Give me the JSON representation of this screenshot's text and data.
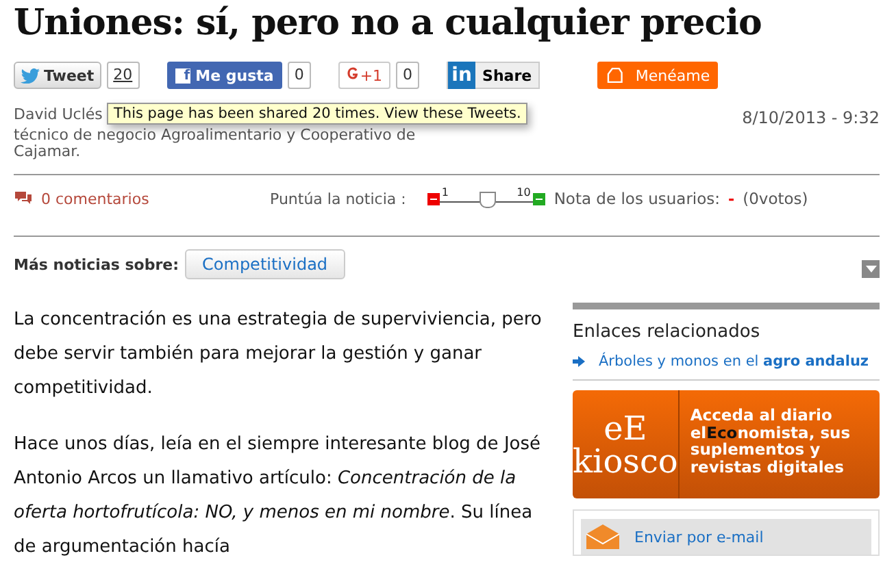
{
  "title": "Uniones: sí, pero no a cualquier precio",
  "social": {
    "tweet": "Tweet",
    "tweet_count": "20",
    "like_logo": "f",
    "like": "Me gusta",
    "like_count": "0",
    "gplus": "+1",
    "gplus_count": "0",
    "linkedin_logo": "in",
    "linkedin": "Share",
    "meneame": "Menéame"
  },
  "tooltip": "This page has been shared 20 times. View these Tweets.",
  "author": {
    "name": "David Uclés",
    "role": "técnico de negocio Agroalimentario y Cooperativo de Cajamar.",
    "date": "8/10/2013 - 9:32"
  },
  "comments": "0 comentarios",
  "rating": {
    "label": "Puntúa la noticia :",
    "min": "1",
    "max": "10",
    "level": 0.5,
    "users_label": "Nota de los usuarios:",
    "users_score": "-",
    "votes": "(0votos)"
  },
  "more_news": {
    "label": "Más noticias sobre:",
    "tags": [
      "Competitividad"
    ]
  },
  "paragraphs": [
    "La concentración es una estrategia de superviviencia, pero debe servir también para mejorar la gestión y ganar competitividad.",
    "Hace unos días, leía en el siempre interesante blog de José Antonio Arcos un llamativo artículo: *Concentración de la oferta hortofrutícola: NO, y menos en mi nombre*. Su línea de argumentación hacía"
  ],
  "sidebar": {
    "heading": "Enlaces relacionados",
    "links": [
      "Árboles y monos en el **agro andaluz**"
    ],
    "kiosco": {
      "logo_top": "eE",
      "logo_bottom": "kiosco",
      "text": "Acceda al diario el**Eco**nomista, sus suplementos y revistas digitales"
    },
    "email": "Enviar por e-mail"
  }
}
